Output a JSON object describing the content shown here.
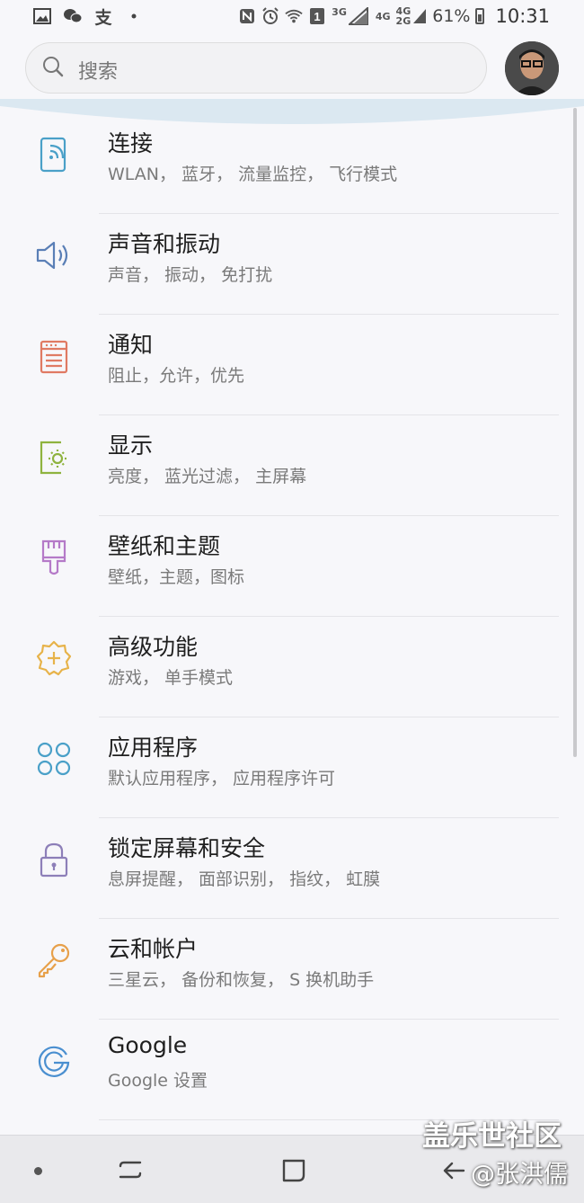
{
  "status_bar": {
    "left_icons": [
      "gallery-icon",
      "wechat-icon",
      "alipay-icon",
      "dot-icon"
    ],
    "right_icons": [
      "nfc-icon",
      "alarm-icon",
      "wifi-icon",
      "sim1-icon",
      "3g-signal-icon",
      "4g-icon",
      "4g-2g-signal-icon"
    ],
    "label_3g": "3G",
    "label_4g": "4G",
    "label_4g_top": "4G",
    "label_2g_bottom": "2G",
    "battery_percent": "61%",
    "time": "10:31"
  },
  "search": {
    "placeholder": "搜索"
  },
  "settings": [
    {
      "icon": "connections-icon",
      "title": "连接",
      "subtitle": "WLAN， 蓝牙， 流量监控， 飞行模式",
      "color": "#4aa0c8"
    },
    {
      "icon": "sound-icon",
      "title": "声音和振动",
      "subtitle": "声音， 振动， 免打扰",
      "color": "#5a7fb6"
    },
    {
      "icon": "notification-icon",
      "title": "通知",
      "subtitle": "阻止，允许，优先",
      "color": "#e07a63"
    },
    {
      "icon": "display-icon",
      "title": "显示",
      "subtitle": "亮度， 蓝光过滤， 主屏幕",
      "color": "#8fb33f"
    },
    {
      "icon": "wallpaper-icon",
      "title": "壁纸和主题",
      "subtitle": "壁纸，主题，图标",
      "color": "#b57ac8"
    },
    {
      "icon": "advanced-features-icon",
      "title": "高级功能",
      "subtitle": "游戏， 单手模式",
      "color": "#e7b34a"
    },
    {
      "icon": "apps-icon",
      "title": "应用程序",
      "subtitle": "默认应用程序， 应用程序许可",
      "color": "#4aa0c8"
    },
    {
      "icon": "lock-icon",
      "title": "锁定屏幕和安全",
      "subtitle": "息屏提醒， 面部识别， 指纹， 虹膜",
      "color": "#8d7fb8"
    },
    {
      "icon": "key-icon",
      "title": "云和帐户",
      "subtitle": "三星云， 备份和恢复， S 换机助手",
      "color": "#e7a04a"
    },
    {
      "icon": "google-icon",
      "title": "Google",
      "subtitle": "Google 设置",
      "color": "#4a8fd0"
    }
  ],
  "watermark": {
    "line1": "盖乐世社区",
    "line2": "@张洪儒"
  }
}
